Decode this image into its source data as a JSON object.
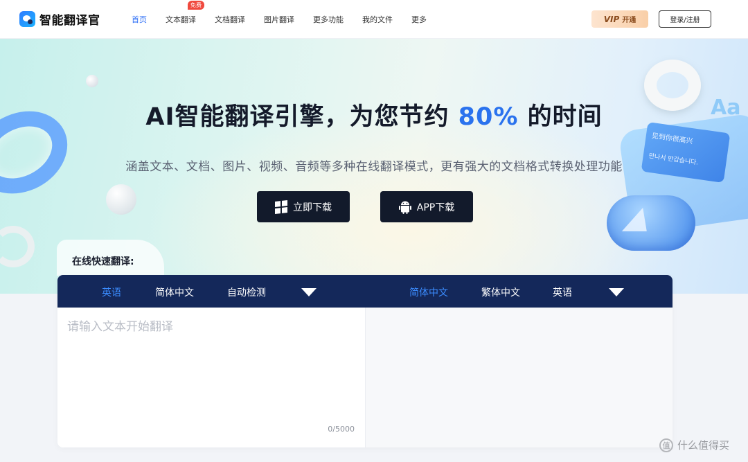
{
  "header": {
    "logo_text": "智能翻译官",
    "nav": [
      {
        "label": "首页",
        "active": true
      },
      {
        "label": "文本翻译",
        "badge": "免费"
      },
      {
        "label": "文档翻译"
      },
      {
        "label": "图片翻译"
      },
      {
        "label": "更多功能"
      },
      {
        "label": "我的文件"
      },
      {
        "label": "更多"
      }
    ],
    "vip_logo": "VIP",
    "vip_label": "开通",
    "login_label": "登录/注册"
  },
  "hero": {
    "title_prefix": "AI智能翻译引擎，为您节约 ",
    "title_highlight": "80%",
    "title_suffix": " 的时间",
    "subtitle": "涵盖文本、文档、图片、视频、音频等多种在线翻译模式，更有强大的文档格式转换处理功能",
    "download_btn": "立即下载",
    "app_btn": "APP下载",
    "deco_tag": "Aa",
    "card_text_1": "见到你很高兴",
    "card_text_2": "만나서 반갑습니다."
  },
  "translate": {
    "section_label": "在线快速翻译:",
    "source_langs": [
      {
        "label": "英语",
        "selected": true
      },
      {
        "label": "简体中文",
        "selected": false
      },
      {
        "label": "自动检测",
        "selected": false
      }
    ],
    "target_langs": [
      {
        "label": "简体中文",
        "selected": true
      },
      {
        "label": "繁体中文",
        "selected": false
      },
      {
        "label": "英语",
        "selected": false
      }
    ],
    "placeholder": "请输入文本开始翻译",
    "counter": "0/5000"
  },
  "watermark": {
    "icon": "值",
    "text": "什么值得买"
  },
  "colors": {
    "accent": "#2a72ee",
    "dark_button": "#121a2b",
    "lang_bar": "#14285a",
    "badge": "#f0493e"
  }
}
